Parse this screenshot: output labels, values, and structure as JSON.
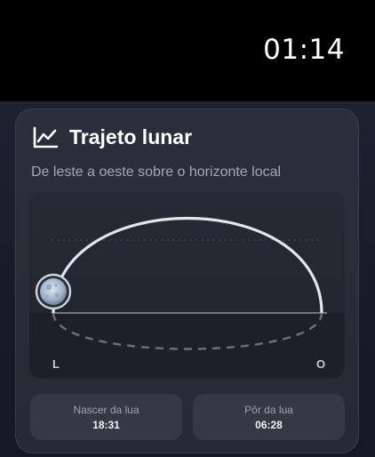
{
  "status_bar": {
    "time": "01:14"
  },
  "card": {
    "title": "Trajeto lunar",
    "title_icon": "line-chart-icon",
    "subtitle": "De leste a oeste sobre o horizonte local"
  },
  "plot": {
    "east_label": "L",
    "west_label": "O",
    "moon_icon": "moon-icon",
    "arc_color": "#e4e5e8",
    "horizon_color": "#8d919a"
  },
  "stats": [
    {
      "label": "Nascer da lua",
      "value": "18:31"
    },
    {
      "label": "Pôr da lua",
      "value": "06:28"
    }
  ]
}
